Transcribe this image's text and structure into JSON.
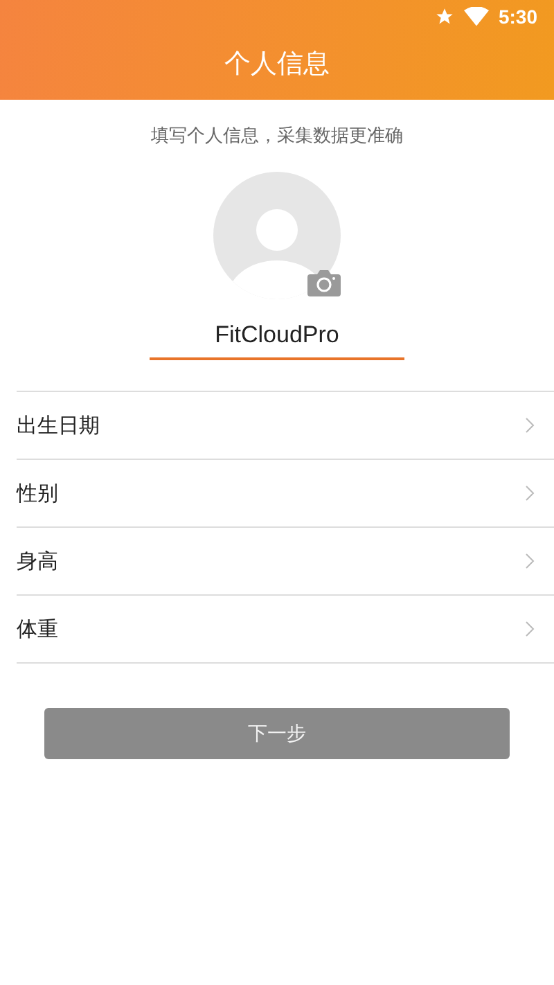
{
  "status_bar": {
    "time": "5:30"
  },
  "header": {
    "title": "个人信息"
  },
  "hint": "填写个人信息，采集数据更准确",
  "name_field": {
    "value": "FitCloudPro"
  },
  "fields": [
    {
      "label": "出生日期"
    },
    {
      "label": "性别"
    },
    {
      "label": "身高"
    },
    {
      "label": "体重"
    }
  ],
  "next_button": {
    "label": "下一步",
    "disabled": true
  }
}
